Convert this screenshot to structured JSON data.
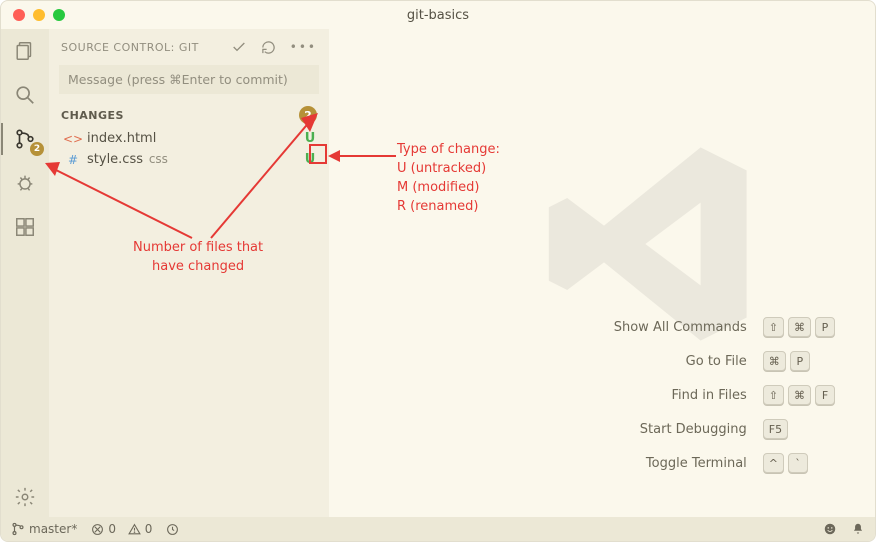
{
  "window": {
    "title": "git-basics"
  },
  "activitybar": {
    "scm_badge": "2",
    "items": [
      {
        "name": "explorer-icon"
      },
      {
        "name": "search-icon"
      },
      {
        "name": "source-control-icon",
        "badge": "2"
      },
      {
        "name": "debug-icon"
      },
      {
        "name": "extensions-icon"
      }
    ]
  },
  "scm": {
    "title": "SOURCE CONTROL: GIT",
    "input_placeholder": "Message (press ⌘Enter to commit)",
    "section": "CHANGES",
    "count": "2",
    "files": [
      {
        "name": "index.html",
        "ext": "",
        "status": "U",
        "type": "html"
      },
      {
        "name": "style.css",
        "ext": "css",
        "status": "U",
        "type": "css"
      }
    ]
  },
  "shortcuts": [
    {
      "label": "Show All Commands",
      "keys": [
        "⇧",
        "⌘",
        "P"
      ]
    },
    {
      "label": "Go to File",
      "keys": [
        "⌘",
        "P"
      ]
    },
    {
      "label": "Find in Files",
      "keys": [
        "⇧",
        "⌘",
        "F"
      ]
    },
    {
      "label": "Start Debugging",
      "keys": [
        "F5"
      ]
    },
    {
      "label": "Toggle Terminal",
      "keys": [
        "^",
        "`"
      ]
    }
  ],
  "statusbar": {
    "branch": "master*",
    "errors": "0",
    "warnings": "0"
  },
  "annotations": {
    "left": "Number of files that\nhave changed",
    "right": "Type of change:\nU (untracked)\nM (modified)\nR (renamed)"
  }
}
